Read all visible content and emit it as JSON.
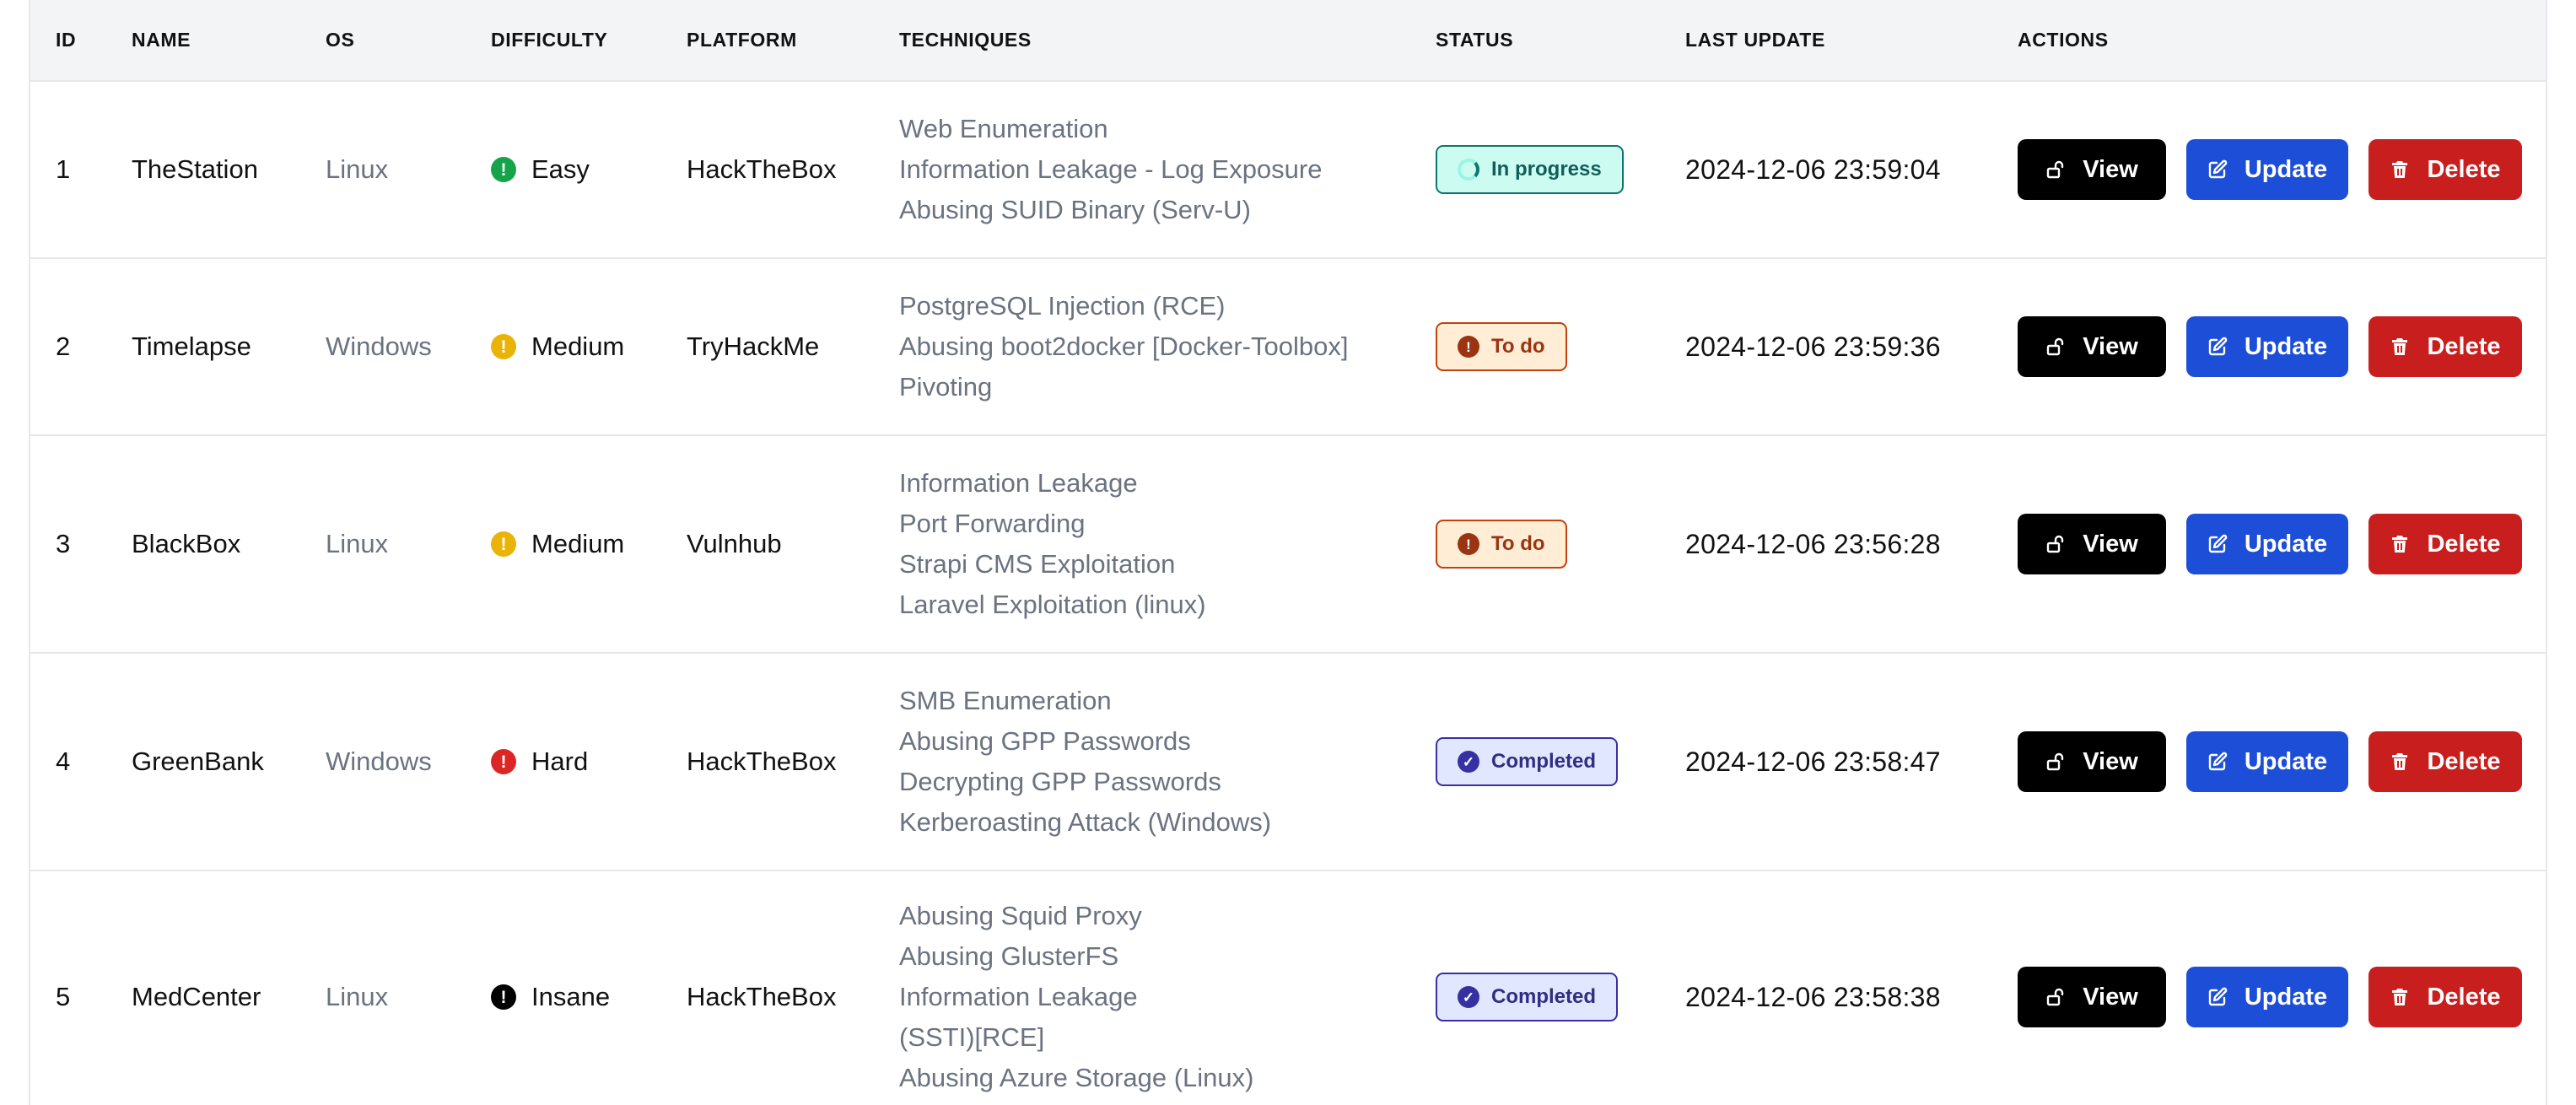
{
  "headers": {
    "id": "ID",
    "name": "NAME",
    "os": "OS",
    "difficulty": "DIFFICULTY",
    "platform": "PLATFORM",
    "techniques": "TECHNIQUES",
    "status": "STATUS",
    "last_update": "LAST UPDATE",
    "actions": "ACTIONS"
  },
  "buttons": {
    "view": "View",
    "update": "Update",
    "delete": "Delete"
  },
  "colors": {
    "easy": "#16a34a",
    "medium": "#eab308",
    "hard": "#dc2626",
    "insane": "#000000"
  },
  "rows": [
    {
      "id": "1",
      "name": "TheStation",
      "os": "Linux",
      "difficulty": "Easy",
      "difficulty_icon": "exclamation-circle-icon",
      "platform": "HackTheBox",
      "techniques": [
        "Web Enumeration",
        "Information Leakage - Log Exposure",
        "Abusing SUID Binary (Serv-U)"
      ],
      "status": "In progress",
      "status_icon": "spinner-icon",
      "last_update": "2024-12-06 23:59:04"
    },
    {
      "id": "2",
      "name": "Timelapse",
      "os": "Windows",
      "difficulty": "Medium",
      "difficulty_icon": "exclamation-circle-icon",
      "platform": "TryHackMe",
      "techniques": [
        "PostgreSQL Injection (RCE)",
        "Abusing boot2docker [Docker-Toolbox]",
        "Pivoting"
      ],
      "status": "To do",
      "status_icon": "exclamation-circle-icon",
      "last_update": "2024-12-06 23:59:36"
    },
    {
      "id": "3",
      "name": "BlackBox",
      "os": "Linux",
      "difficulty": "Medium",
      "difficulty_icon": "exclamation-circle-icon",
      "platform": "Vulnhub",
      "techniques": [
        "Information Leakage",
        "Port Forwarding",
        "Strapi CMS Exploitation",
        "Laravel Exploitation (linux)"
      ],
      "status": "To do",
      "status_icon": "exclamation-circle-icon",
      "last_update": "2024-12-06 23:56:28"
    },
    {
      "id": "4",
      "name": "GreenBank",
      "os": "Windows",
      "difficulty": "Hard",
      "difficulty_icon": "exclamation-circle-icon",
      "platform": "HackTheBox",
      "techniques": [
        "SMB Enumeration",
        "Abusing GPP Passwords",
        "Decrypting GPP Passwords",
        "Kerberoasting Attack (Windows)"
      ],
      "status": "Completed",
      "status_icon": "check-circle-icon",
      "last_update": "2024-12-06 23:58:47"
    },
    {
      "id": "5",
      "name": "MedCenter",
      "os": "Linux",
      "difficulty": "Insane",
      "difficulty_icon": "exclamation-circle-icon",
      "platform": "HackTheBox",
      "techniques": [
        "Abusing Squid Proxy",
        "Abusing GlusterFS",
        "Information Leakage",
        "(SSTI)[RCE]",
        "Abusing Azure Storage (Linux)"
      ],
      "status": "Completed",
      "status_icon": "check-circle-icon",
      "last_update": "2024-12-06 23:58:38"
    }
  ]
}
